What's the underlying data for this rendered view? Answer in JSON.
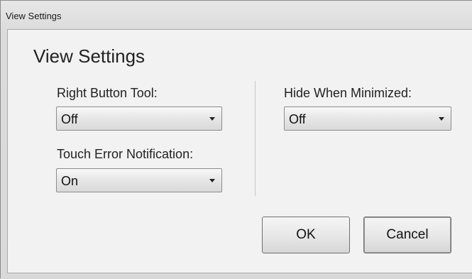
{
  "window": {
    "title": "View Settings"
  },
  "dialog": {
    "heading": "View Settings",
    "right_button_tool": {
      "label": "Right Button Tool:",
      "value": "Off"
    },
    "touch_error_notification": {
      "label": "Touch Error Notification:",
      "value": "On"
    },
    "hide_when_minimized": {
      "label": "Hide When Minimized:",
      "value": "Off"
    },
    "buttons": {
      "ok": "OK",
      "cancel": "Cancel"
    }
  }
}
